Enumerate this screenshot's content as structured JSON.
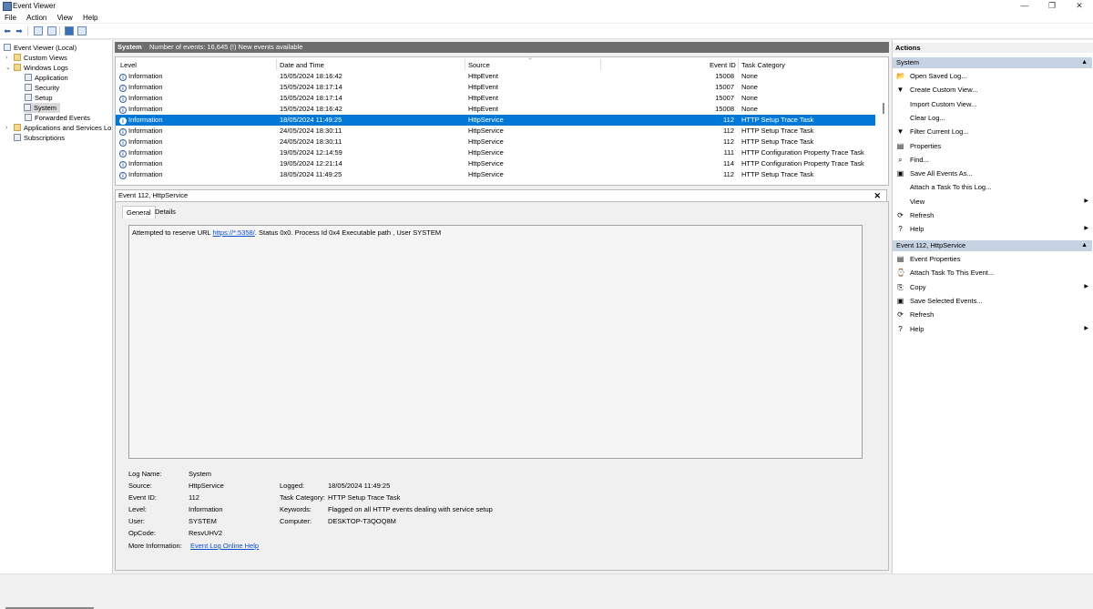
{
  "window": {
    "title": "Event Viewer",
    "min": "—",
    "max": "❐",
    "close": "✕"
  },
  "menu": [
    "File",
    "Action",
    "View",
    "Help"
  ],
  "tree": [
    {
      "label": "Event Viewer (Local)",
      "level": 0,
      "expander": "⌄"
    },
    {
      "label": "Custom Views",
      "level": 1,
      "expander": "›"
    },
    {
      "label": "Windows Logs",
      "level": 1,
      "expander": "⌄"
    },
    {
      "label": "Application",
      "level": 2
    },
    {
      "label": "Security",
      "level": 2
    },
    {
      "label": "Setup",
      "level": 2
    },
    {
      "label": "System",
      "level": 2,
      "selected": true
    },
    {
      "label": "Forwarded Events",
      "level": 2
    },
    {
      "label": "Applications and Services Lo",
      "level": 1,
      "expander": "›"
    },
    {
      "label": "Subscriptions",
      "level": 1
    }
  ],
  "log_header": {
    "name": "System",
    "summary": "Number of events: 16,645 (!) New events available"
  },
  "columns": {
    "level": "Level",
    "date": "Date and Time",
    "source": "Source",
    "event_id": "Event ID",
    "task": "Task Category"
  },
  "events": [
    {
      "level": "Information",
      "date": "15/05/2024 18:16:42",
      "source": "HttpEvent",
      "id": "15008",
      "task": "None"
    },
    {
      "level": "Information",
      "date": "15/05/2024 18:17:14",
      "source": "HttpEvent",
      "id": "15007",
      "task": "None"
    },
    {
      "level": "Information",
      "date": "15/05/2024 18:17:14",
      "source": "HttpEvent",
      "id": "15007",
      "task": "None"
    },
    {
      "level": "Information",
      "date": "15/05/2024 18:16:42",
      "source": "HttpEvent",
      "id": "15008",
      "task": "None"
    },
    {
      "level": "Information",
      "date": "18/05/2024 11:49:25",
      "source": "HttpService",
      "id": "112",
      "task": "HTTP Setup Trace Task",
      "selected": true
    },
    {
      "level": "Information",
      "date": "24/05/2024 18:30:11",
      "source": "HttpService",
      "id": "112",
      "task": "HTTP Setup Trace Task"
    },
    {
      "level": "Information",
      "date": "24/05/2024 18:30:11",
      "source": "HttpService",
      "id": "112",
      "task": "HTTP Setup Trace Task"
    },
    {
      "level": "Information",
      "date": "19/05/2024 12:14:59",
      "source": "HttpService",
      "id": "111",
      "task": "HTTP Configuration Property Trace Task"
    },
    {
      "level": "Information",
      "date": "19/05/2024 12:21:14",
      "source": "HttpService",
      "id": "114",
      "task": "HTTP Configuration Property Trace Task"
    },
    {
      "level": "Information",
      "date": "18/05/2024 11:49:25",
      "source": "HttpService",
      "id": "112",
      "task": "HTTP Setup Trace Task"
    }
  ],
  "detail": {
    "title": "Event 112, HttpService",
    "close": "✕",
    "tabs": [
      "General",
      "Details"
    ],
    "message_pre": "Attempted to reserve URL ",
    "message_link": "https://*:5358/",
    "message_post": ". Status 0x0. Process Id 0x4 Executable path , User SYSTEM",
    "fields": {
      "log_name_label": "Log Name:",
      "log_name": "System",
      "source_label": "Source:",
      "source": "HttpService",
      "logged_label": "Logged:",
      "logged": "18/05/2024 11:49:25",
      "event_id_label": "Event ID:",
      "event_id": "112",
      "task_label": "Task Category:",
      "task": "HTTP Setup Trace Task",
      "level_label": "Level:",
      "level": "Information",
      "keywords_label": "Keywords:",
      "keywords": "Flagged on all HTTP events dealing with service setup",
      "user_label": "User:",
      "user": "SYSTEM",
      "computer_label": "Computer:",
      "computer": "DESKTOP-T3QOQ8M",
      "opcode_label": "OpCode:",
      "opcode": "ResvUHV2",
      "more_info_label": "More Information:",
      "more_info": "Event Log Online Help"
    }
  },
  "actions": {
    "title": "Actions",
    "section1": "System",
    "section1_items": [
      {
        "label": "Open Saved Log...",
        "icon": "📂"
      },
      {
        "label": "Create Custom View...",
        "icon": "▼"
      },
      {
        "label": "Import Custom View...",
        "icon": ""
      },
      {
        "label": "Clear Log...",
        "icon": ""
      },
      {
        "label": "Filter Current Log...",
        "icon": "▼"
      },
      {
        "label": "Properties",
        "icon": "▤"
      },
      {
        "label": "Find...",
        "icon": "⌕"
      },
      {
        "label": "Save All Events As...",
        "icon": "▣"
      },
      {
        "label": "Attach a Task To this Log...",
        "icon": ""
      },
      {
        "label": "View",
        "icon": "",
        "submenu": true
      },
      {
        "label": "Refresh",
        "icon": "⟳"
      },
      {
        "label": "Help",
        "icon": "?",
        "submenu": true
      }
    ],
    "section2": "Event 112, HttpService",
    "section2_items": [
      {
        "label": "Event Properties",
        "icon": "▤"
      },
      {
        "label": "Attach Task To This Event...",
        "icon": "⌚"
      },
      {
        "label": "Copy",
        "icon": "⎘",
        "submenu": true
      },
      {
        "label": "Save Selected Events...",
        "icon": "▣"
      },
      {
        "label": "Refresh",
        "icon": "⟳"
      },
      {
        "label": "Help",
        "icon": "?",
        "submenu": true
      }
    ]
  }
}
